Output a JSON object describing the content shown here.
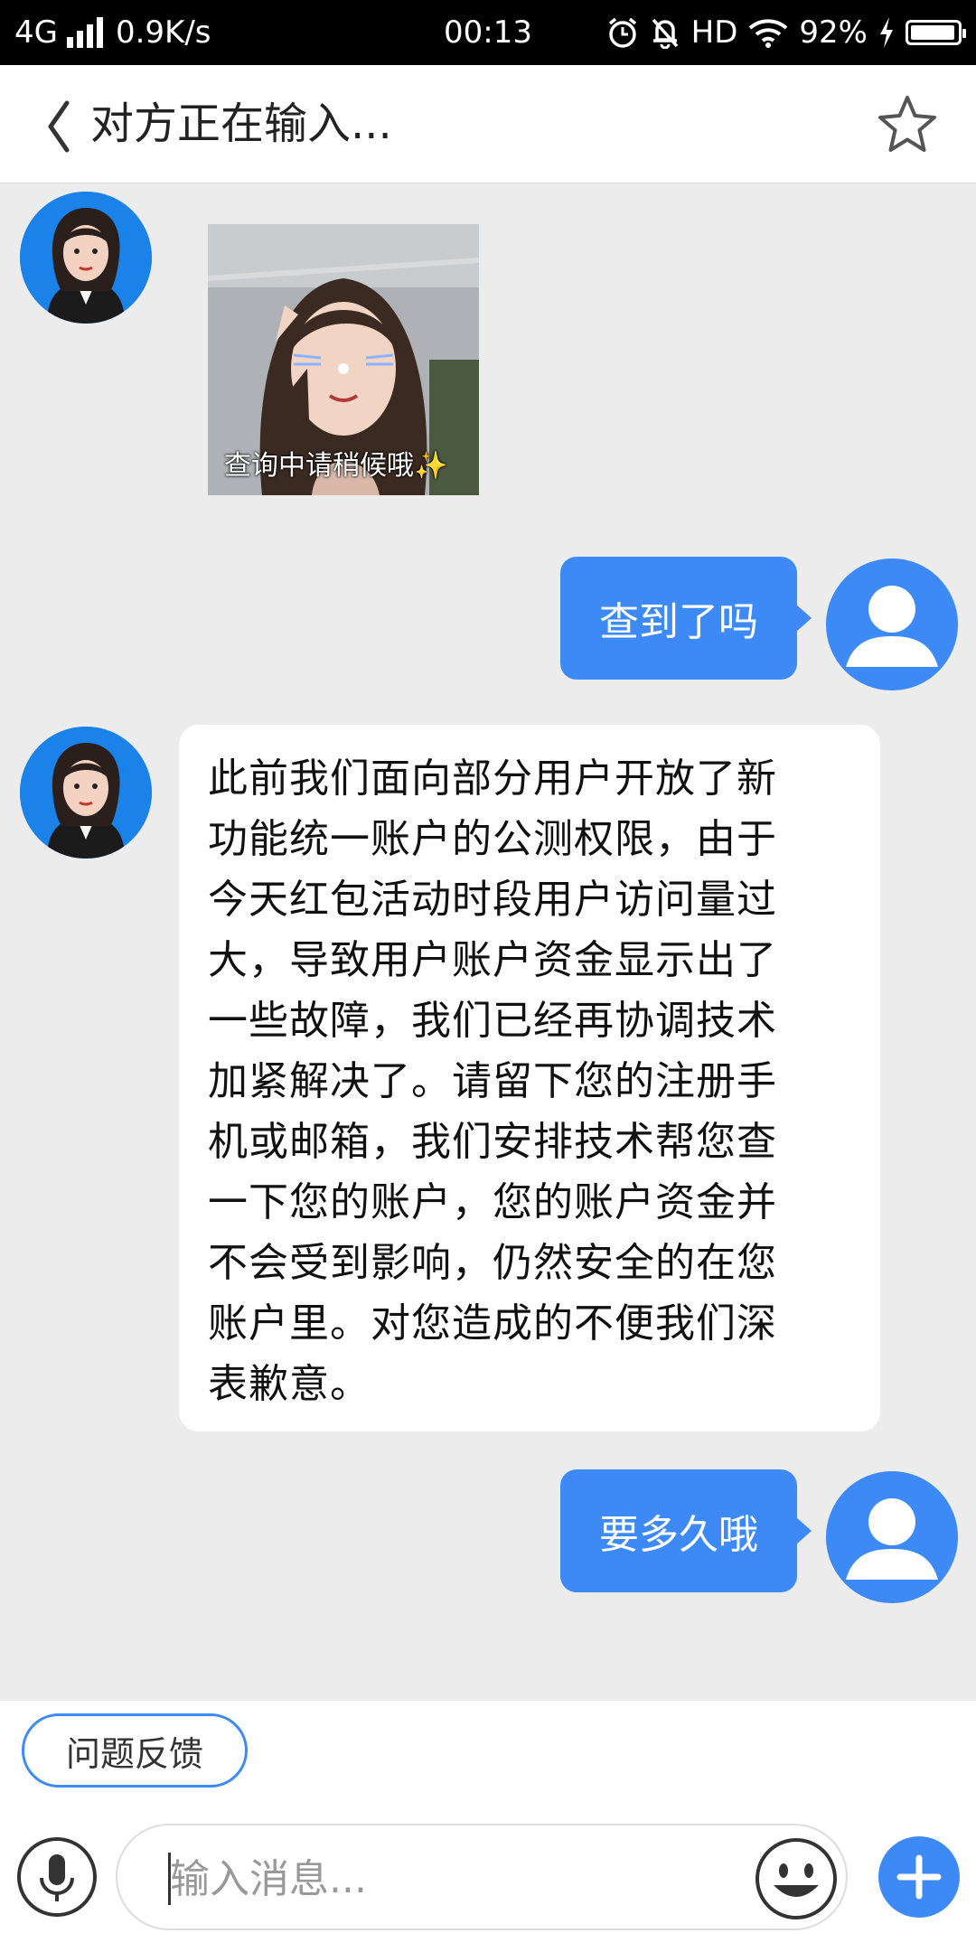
{
  "status_bar": {
    "network": "4G",
    "speed": "0.9K/s",
    "time": "00:13",
    "hd": "HD",
    "battery": "92%",
    "battery_level": 0.92
  },
  "header": {
    "title": "对方正在输入...",
    "back_icon": "chevron-left-icon",
    "favorite_icon": "star-outline-icon"
  },
  "messages": {
    "m1": {
      "sender": "agent",
      "type": "sticker",
      "caption": "查询中请稍候哦✨"
    },
    "m2": {
      "sender": "user",
      "text": "查到了吗"
    },
    "m3": {
      "sender": "agent",
      "lines": [
        "此前我们面向部分用户开放了新",
        "功能统一账户的公测权限，由于",
        "今天红包活动时段用户访问量过",
        "大，导致用户账户资金显示出了",
        "一些故障，我们已经再协调技术",
        "加紧解决了。请留下您的注册手",
        "机或邮箱，我们安排技术帮您查",
        "一下您的账户，您的账户资金并",
        "不会受到影响，仍然安全的在您",
        "账户里。对您造成的不便我们深",
        "表歉意。"
      ]
    },
    "m4": {
      "sender": "user",
      "text": "要多久哦"
    }
  },
  "bottom": {
    "feedback_label": "问题反馈",
    "input_placeholder": "输入消息...",
    "icons": [
      "microphone-icon",
      "emoji-icon",
      "plus-icon"
    ]
  },
  "colors": {
    "accent": "#3d8af7",
    "background": "#ececec",
    "agent_avatar_bg": "#1a82e8"
  }
}
